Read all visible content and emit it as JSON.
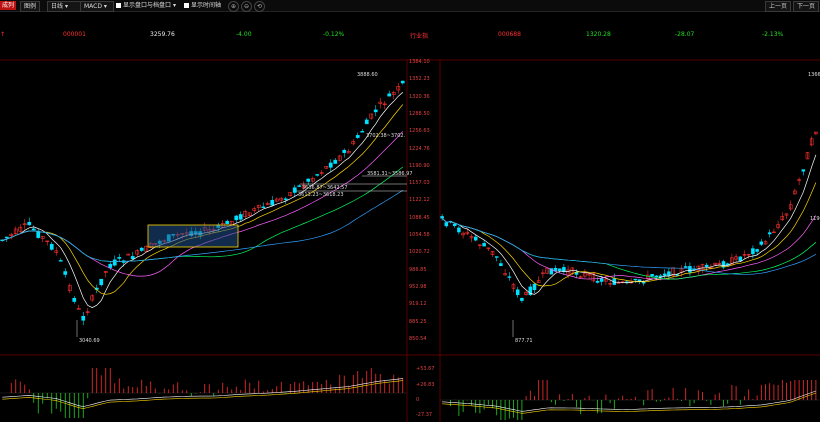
{
  "toolbar": {
    "tab_left": "成列",
    "btn_chart": "图例",
    "period": "日线",
    "indicator": "MACD",
    "check1": "显示盘口与档盘口",
    "check2": "显示时间轴",
    "zoom_in": "⊕",
    "zoom_out": "⊖",
    "undo": "⟲",
    "prev": "上一页",
    "next": "下一页"
  },
  "left_quote": {
    "code": "000001",
    "price": "3259.76",
    "change": "-4.00",
    "pct": "-0.12%"
  },
  "right_quote": {
    "prefix": "行业指",
    "code": "000688",
    "price": "1320.28",
    "change": "-28.07",
    "pct": "-2.13%"
  },
  "right_axis": {
    "main": [
      "1384.10",
      "1352.23",
      "1320.36",
      "1288.50",
      "1256.63",
      "1224.76",
      "1190.90",
      "1157.03",
      "1122.12",
      "1088.45",
      "1054.58",
      "1020.72",
      "986.85",
      "952.98",
      "919.12",
      "885.25",
      "850.54"
    ],
    "macd": [
      "+53.67",
      "+26.83",
      "0",
      "-27.37"
    ]
  },
  "left_labels": {
    "high": "3888.60",
    "low": "3040.69",
    "ann1": "3702.38~3702.",
    "ann2": "3581.31~3586.97",
    "ann3": "3636.87~3642.57",
    "ann4": "3613.23~3618.23"
  },
  "right_labels": {
    "high": "1366",
    "low": "877.71",
    "ann1": "1190"
  },
  "colors": {
    "up": "#ff3030",
    "down": "#00e0ff",
    "ma5": "#ffffff",
    "ma10": "#ffd700",
    "ma20": "#ff60ff",
    "ma60": "#00ff60",
    "ma120": "#30a0ff",
    "grid": "#5a0000"
  }
}
